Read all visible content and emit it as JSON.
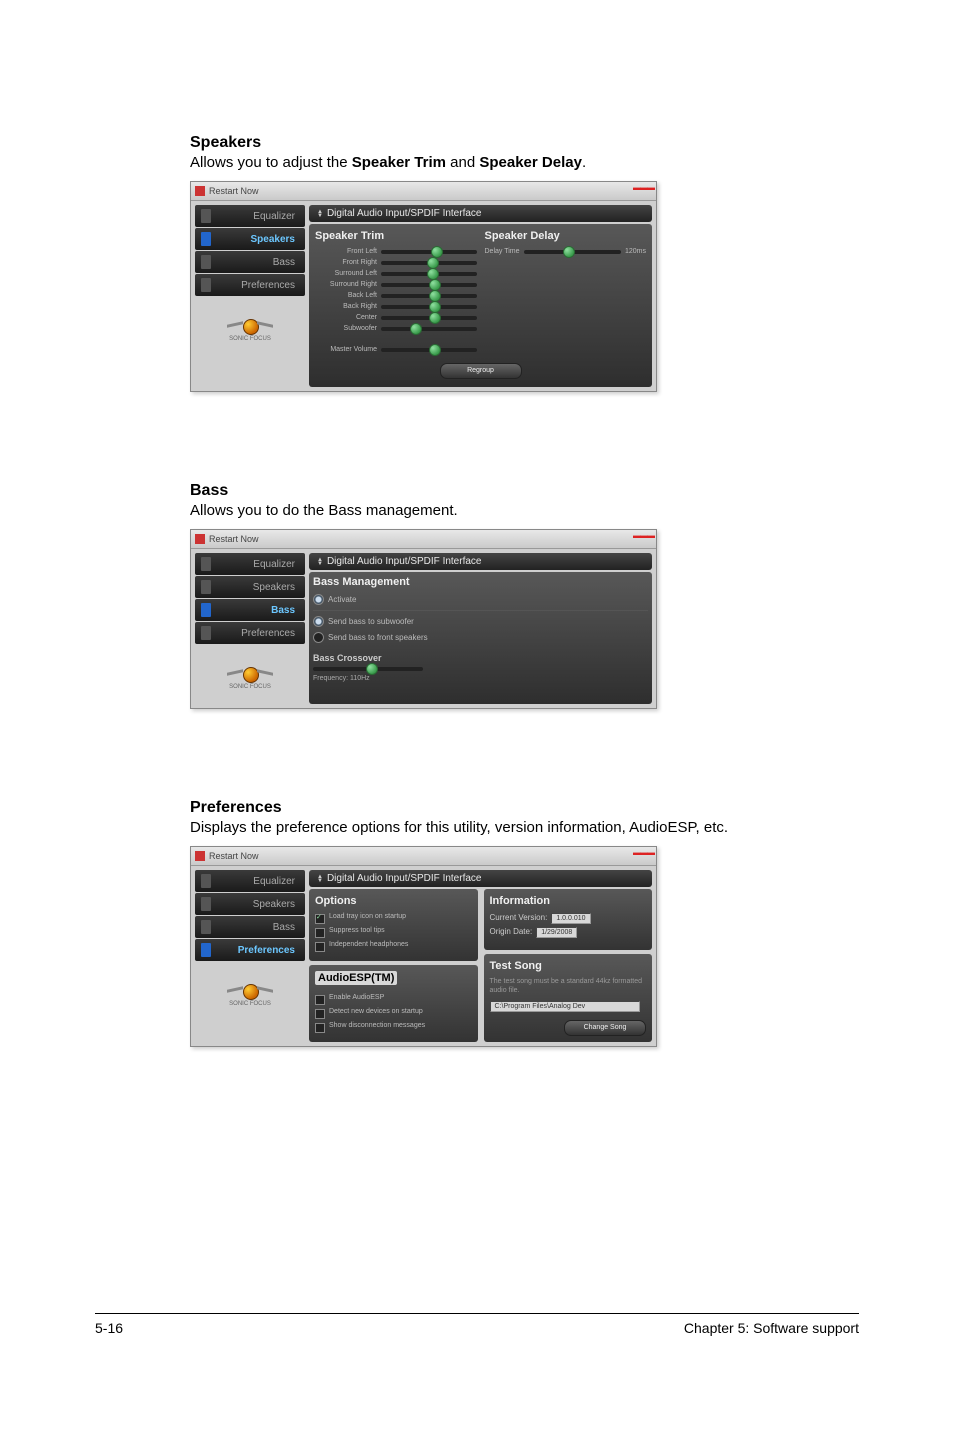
{
  "sections": {
    "speakers": {
      "title": "Speakers",
      "desc_pre": "Allows you to adjust the ",
      "desc_b1": "Speaker Trim",
      "desc_mid": " and ",
      "desc_b2": "Speaker Delay",
      "desc_post": "."
    },
    "bass": {
      "title": "Bass",
      "desc": "Allows you to do the Bass management."
    },
    "preferences": {
      "title": "Preferences",
      "desc": "Displays the preference options for this utility, version information, AudioESP, etc."
    }
  },
  "windows": {
    "titlebar_text": "Restart Now",
    "close_glyph": "▬▬▬",
    "dropdown_label": "Digital Audio Input/SPDIF Interface",
    "sidebar": {
      "equalizer": "Equalizer",
      "speakers": "Speakers",
      "bass": "Bass",
      "preferences": "Preferences"
    },
    "logo_text": "SONIC FOCUS"
  },
  "speakers_panel": {
    "left_title": "Speaker Trim",
    "right_title": "Speaker Delay",
    "sliders": [
      "Front Left",
      "Front Right",
      "Surround Left",
      "Surround Right",
      "Back Left",
      "Back Right",
      "Center",
      "Subwoofer"
    ],
    "master": "Master Volume",
    "delay_label": "Delay Time",
    "delay_value": "120ms",
    "button": "Regroup"
  },
  "bass_panel": {
    "title": "Bass Management",
    "activate": "Activate",
    "r1": "Send bass to subwoofer",
    "r2": "Send bass to front speakers",
    "crossover_title": "Bass Crossover",
    "crossover_freq": "Frequency: 110Hz"
  },
  "pref_panel": {
    "options_title": "Options",
    "opt1": "Load tray icon on startup",
    "opt2": "Suppress tool tips",
    "opt3": "Independent headphones",
    "esp_title": "AudioESP(TM)",
    "esp1": "Enable AudioESP",
    "esp2": "Detect new devices on startup",
    "esp3": "Show disconnection messages",
    "info_title": "Information",
    "ver_label": "Current Version:",
    "ver_value": "1.0.0.010",
    "date_label": "Origin Date:",
    "date_value": "1/29/2008",
    "test_title": "Test Song",
    "test_desc": "The test song must be a standard 44kz formatted audio file.",
    "test_path": "C:\\Program Files\\Analog Dev",
    "test_btn": "Change Song"
  },
  "footer": {
    "left": "5-16",
    "right": "Chapter 5: Software support"
  }
}
